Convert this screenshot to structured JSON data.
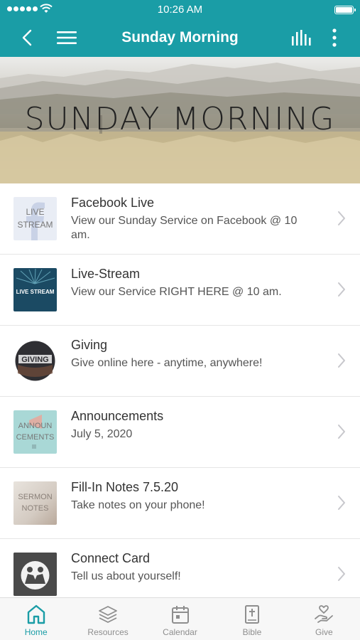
{
  "status_bar": {
    "time": "10:26 AM"
  },
  "nav": {
    "title": "Sunday Morning",
    "icons": [
      "back-chevron-icon",
      "hamburger-menu-icon",
      "stats-bars-icon",
      "more-vertical-icon"
    ]
  },
  "hero": {
    "title": "SUNDAY MORNING"
  },
  "items": [
    {
      "title": "Facebook Live",
      "subtitle": "View our Sunday Service on Facebook @ 10 am.",
      "thumb_text": [
        "LIVE",
        "STREAM"
      ]
    },
    {
      "title": "Live-Stream",
      "subtitle": "View our Service RIGHT HERE @ 10 am.",
      "thumb_text": [
        "LIVE STREAM"
      ]
    },
    {
      "title": "Giving",
      "subtitle": "Give online here - anytime, anywhere!",
      "thumb_text": [
        "GIVING"
      ]
    },
    {
      "title": "Announcements",
      "subtitle": "July 5, 2020",
      "thumb_text": [
        "ANNOUN",
        "CEMENTS"
      ]
    },
    {
      "title": "Fill-In Notes 7.5.20",
      "subtitle": "Take notes on your phone!",
      "thumb_text": [
        "SERMON",
        "NOTES"
      ]
    },
    {
      "title": "Connect Card",
      "subtitle": "Tell us about yourself!",
      "thumb_text": []
    }
  ],
  "tabs": [
    {
      "label": "Home",
      "icon": "home-icon",
      "active": true
    },
    {
      "label": "Resources",
      "icon": "layers-icon",
      "active": false
    },
    {
      "label": "Calendar",
      "icon": "calendar-icon",
      "active": false
    },
    {
      "label": "Bible",
      "icon": "bible-icon",
      "active": false
    },
    {
      "label": "Give",
      "icon": "give-hand-heart-icon",
      "active": false
    }
  ],
  "colors": {
    "brand": "#1a9da6",
    "tab_inactive": "#8e8e8e",
    "chevron": "#c7c7cc"
  }
}
